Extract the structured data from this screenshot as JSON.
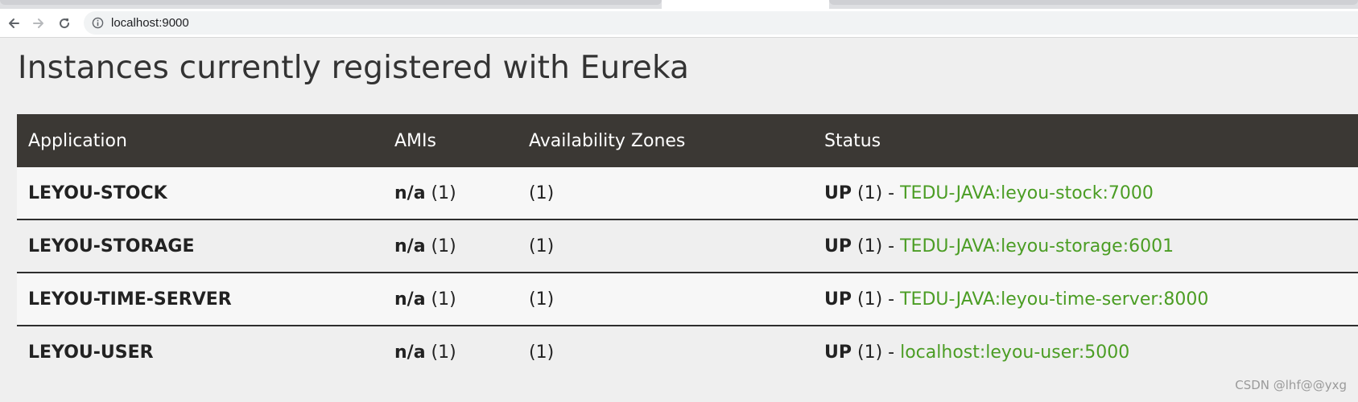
{
  "browser": {
    "url": "localhost:9000",
    "icons": {
      "back": "arrow-left-icon",
      "forward": "arrow-right-icon",
      "reload": "reload-icon",
      "info": "info-icon"
    }
  },
  "page": {
    "title": "Instances currently registered with Eureka"
  },
  "table": {
    "headers": [
      "Application",
      "AMIs",
      "Availability Zones",
      "Status"
    ],
    "rows": [
      {
        "application": "LEYOU-STOCK",
        "ami_value": "n/a",
        "ami_count": "(1)",
        "zones": "(1)",
        "status": "UP",
        "status_count": "(1) -",
        "instance": "TEDU-JAVA:leyou-stock:7000"
      },
      {
        "application": "LEYOU-STORAGE",
        "ami_value": "n/a",
        "ami_count": "(1)",
        "zones": "(1)",
        "status": "UP",
        "status_count": "(1) -",
        "instance": "TEDU-JAVA:leyou-storage:6001"
      },
      {
        "application": "LEYOU-TIME-SERVER",
        "ami_value": "n/a",
        "ami_count": "(1)",
        "zones": "(1)",
        "status": "UP",
        "status_count": "(1) -",
        "instance": "TEDU-JAVA:leyou-time-server:8000"
      },
      {
        "application": "LEYOU-USER",
        "ami_value": "n/a",
        "ami_count": "(1)",
        "zones": "(1)",
        "status": "UP",
        "status_count": "(1) -",
        "instance": "localhost:leyou-user:5000"
      }
    ]
  },
  "colors": {
    "header_bg": "#3b3834",
    "link_green": "#4b9d24"
  },
  "watermark": "CSDN @lhf@@yxg"
}
